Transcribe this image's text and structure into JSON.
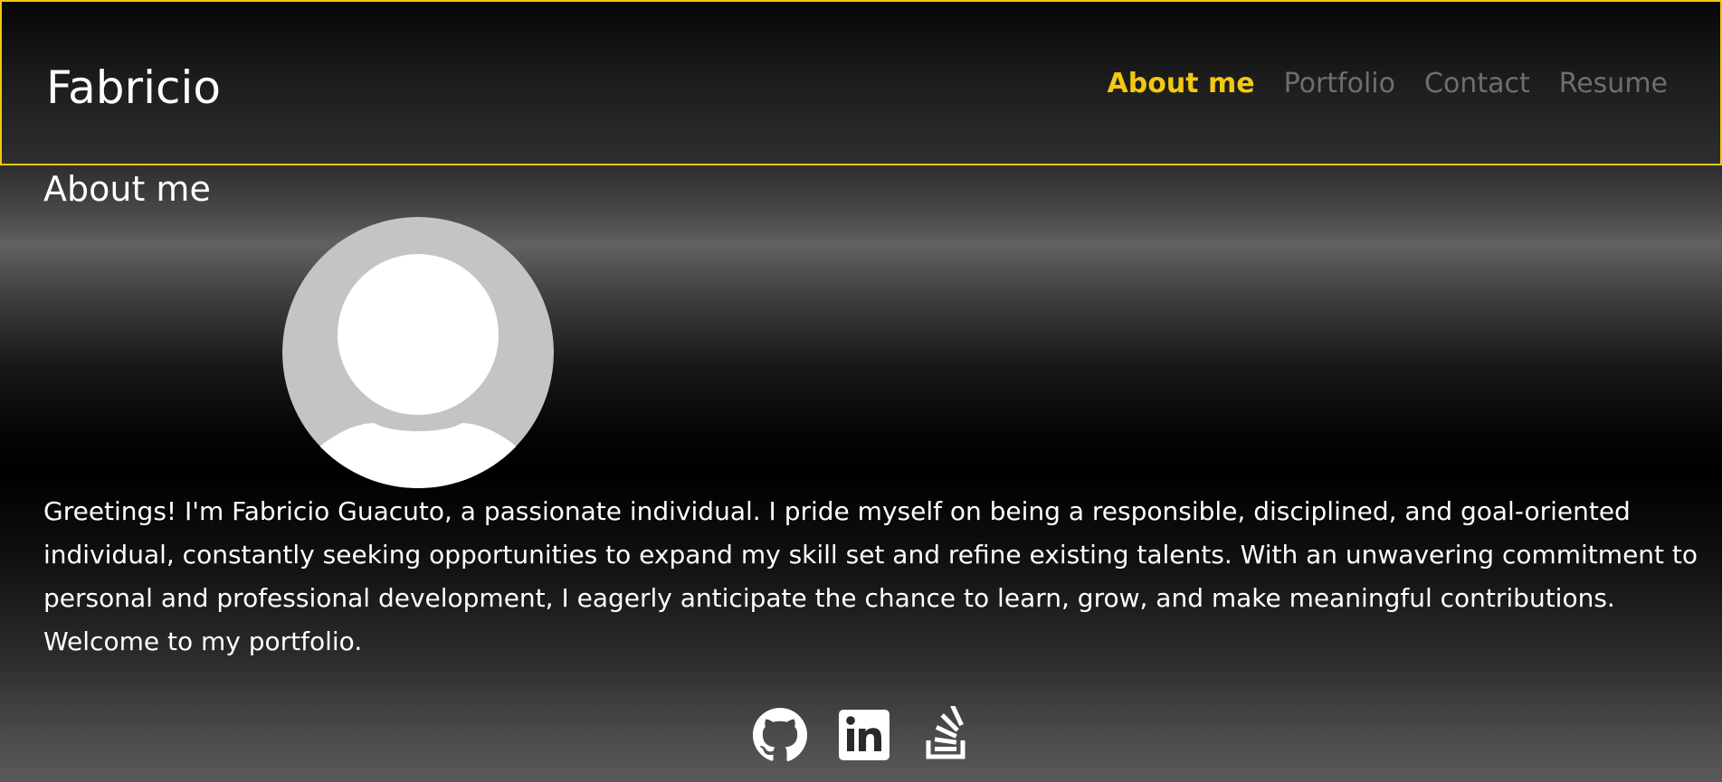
{
  "header": {
    "brand": "Fabricio",
    "nav": [
      {
        "label": "About me",
        "active": true
      },
      {
        "label": "Portfolio",
        "active": false
      },
      {
        "label": "Contact",
        "active": false
      },
      {
        "label": "Resume",
        "active": false
      }
    ]
  },
  "about": {
    "title": "About me",
    "avatar_icon": "default-user-avatar",
    "bio": "Greetings! I'm Fabricio Guacuto, a passionate individual. I pride myself on being a responsible, disciplined, and goal-oriented individual, constantly seeking opportunities to expand my skill set and refine existing talents. With an unwavering commitment to personal and professional development, I eagerly anticipate the chance to learn, grow, and make meaningful contributions. Welcome to my portfolio."
  },
  "social": [
    {
      "icon": "github-icon"
    },
    {
      "icon": "linkedin-icon"
    },
    {
      "icon": "stackoverflow-icon"
    }
  ],
  "colors": {
    "accent": "#f2c811",
    "nav_inactive": "#6e6e6e",
    "text": "#ffffff",
    "avatar_bg": "#c4c4c4"
  }
}
